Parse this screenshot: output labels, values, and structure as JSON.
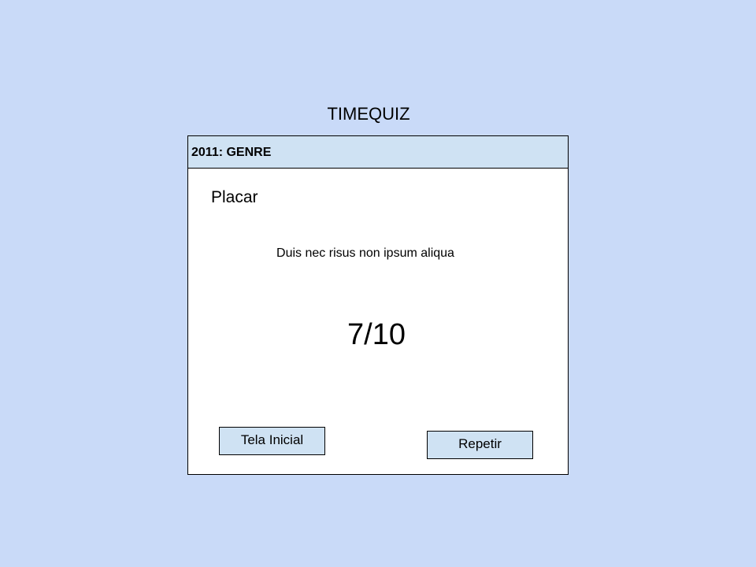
{
  "app": {
    "title": "TIMEQUIZ"
  },
  "panel": {
    "header": "2011: GENRE",
    "score_heading": "Placar",
    "message": "Duis nec risus non ipsum aliqua",
    "score": "7/10"
  },
  "buttons": {
    "home_label": "Tela Inicial",
    "repeat_label": "Repetir"
  },
  "colors": {
    "background": "#c9daf8",
    "header_fill": "#cfe2f3",
    "panel_fill": "#ffffff",
    "button_fill": "#cfe2f3"
  }
}
